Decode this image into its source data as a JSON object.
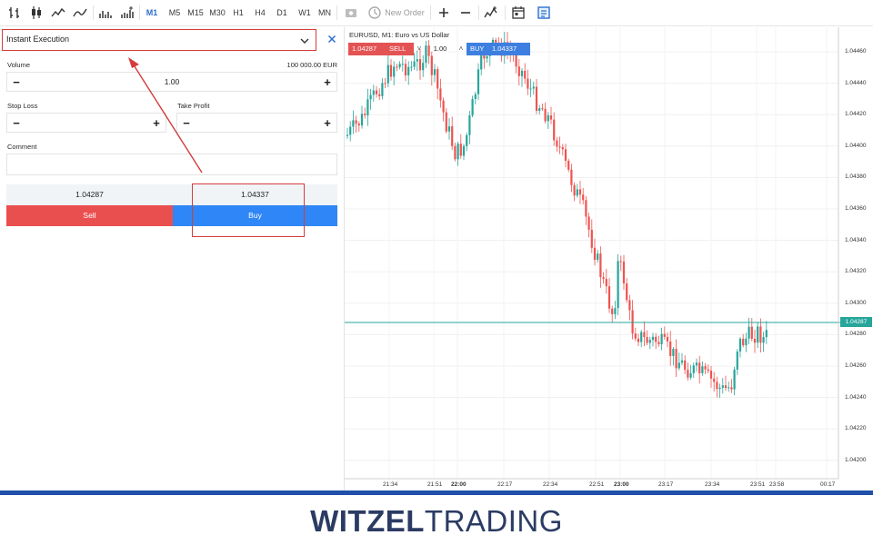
{
  "toolbar": {
    "timeframes": [
      "M1",
      "M5",
      "M15",
      "M30",
      "H1",
      "H4",
      "D1",
      "W1",
      "MN"
    ],
    "active_timeframe": "M1",
    "new_order_label": "New Order",
    "icons": [
      "bar-chart-icon",
      "candlestick-icon",
      "line-chart-icon",
      "area-chart-icon",
      "volume-icon",
      "volume-up-icon",
      "screenshot-icon",
      "clock-icon",
      "zoom-in-icon",
      "zoom-out-icon",
      "indicators-icon",
      "calendar-icon",
      "notes-icon"
    ]
  },
  "order_panel": {
    "execution_type": "Instant Execution",
    "volume_label": "Volume",
    "volume_value": "1.00",
    "volume_note": "100 000.00 EUR",
    "stop_loss_label": "Stop Loss",
    "take_profit_label": "Take Profit",
    "minus_glyph": "−",
    "plus_glyph": "+",
    "comment_label": "Comment",
    "comment_value": "",
    "bid_price": "1.04287",
    "ask_price": "1.04337",
    "sell_label": "Sell",
    "buy_label": "Buy"
  },
  "chart": {
    "title": "EURUSD, M1: Euro vs US Dollar",
    "trade_bar": {
      "sell_price": "1.04287",
      "sell_label": "SELL",
      "volume": "1.00",
      "buy_label": "BUY",
      "buy_price": "1.04337"
    },
    "current_price_label": "1.04287",
    "y_ticks": [
      "1.04460",
      "1.04440",
      "1.04420",
      "1.04400",
      "1.04380",
      "1.04360",
      "1.04340",
      "1.04320",
      "1.04300",
      "1.04280",
      "1.04260",
      "1.04240",
      "1.04220",
      "1.04200"
    ],
    "x_ticks": [
      {
        "label": "21:34",
        "bold": false
      },
      {
        "label": "21:51",
        "bold": false
      },
      {
        "label": "22:00",
        "bold": true
      },
      {
        "label": "22:17",
        "bold": false
      },
      {
        "label": "22:34",
        "bold": false
      },
      {
        "label": "22:51",
        "bold": false
      },
      {
        "label": "23:00",
        "bold": true
      },
      {
        "label": "23:17",
        "bold": false
      },
      {
        "label": "23:34",
        "bold": false
      },
      {
        "label": "23:51",
        "bold": false
      },
      {
        "label": "23:58",
        "bold": false
      },
      {
        "label": "00:17",
        "bold": false
      }
    ],
    "colors": {
      "up": "#26a69a",
      "down": "#ef5350",
      "price_line": "#26a69a"
    }
  },
  "footer": {
    "brand_bold": "WITZEL",
    "brand_regular": "TRADING",
    "accent_color": "#1f4fa8"
  }
}
